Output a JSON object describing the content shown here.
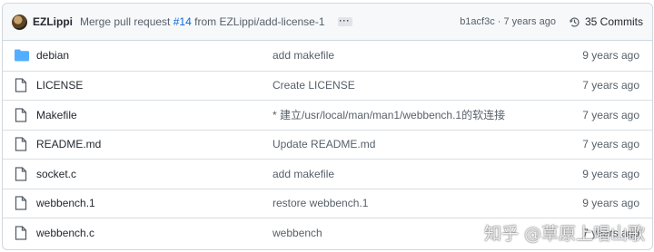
{
  "commit_header": {
    "author": "EZLippi",
    "message_prefix": "Merge pull request",
    "pr_number": "#14",
    "message_suffix": "from EZLippi/add-license-1",
    "sha_time": "b1acf3c · 7 years ago",
    "commits_count": "35 Commits"
  },
  "files": [
    {
      "name": "debian",
      "type": "folder",
      "message": "add makefile",
      "age": "9 years ago"
    },
    {
      "name": "LICENSE",
      "type": "file",
      "message": "Create LICENSE",
      "age": "7 years ago"
    },
    {
      "name": "Makefile",
      "type": "file",
      "message": "* 建立/usr/local/man/man1/webbench.1的软连接",
      "age": "7 years ago"
    },
    {
      "name": "README.md",
      "type": "file",
      "message": "Update README.md",
      "age": "7 years ago"
    },
    {
      "name": "socket.c",
      "type": "file",
      "message": "add makefile",
      "age": "9 years ago"
    },
    {
      "name": "webbench.1",
      "type": "file",
      "message": "restore webbench.1",
      "age": "9 years ago"
    },
    {
      "name": "webbench.c",
      "type": "file",
      "message": "webbench",
      "age": "7 years ago"
    }
  ],
  "watermark": "知乎 @草原上唱山歌",
  "colors": {
    "folder": "#54aeff",
    "link": "#0969da",
    "border": "#d0d7de"
  }
}
